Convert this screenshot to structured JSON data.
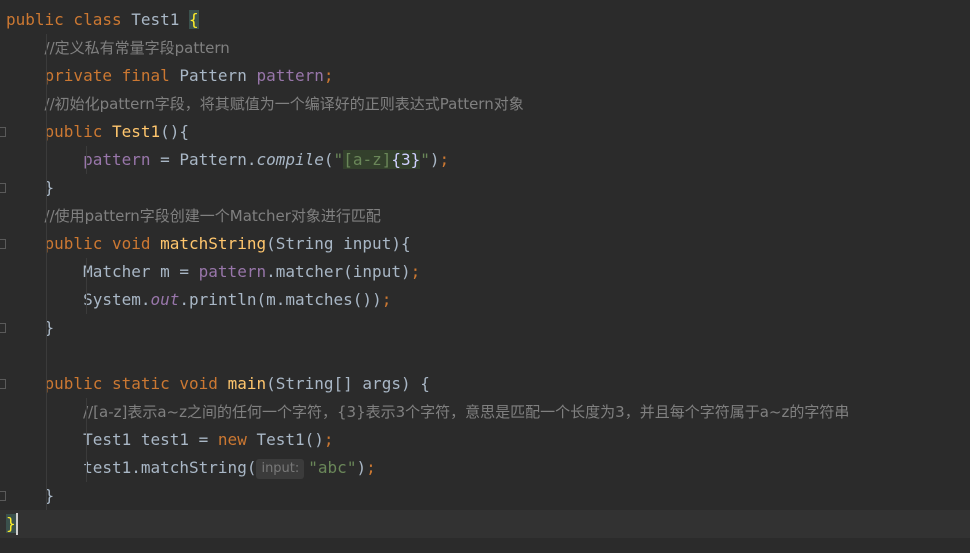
{
  "editor": {
    "lines": [
      {
        "tokens": [
          [
            "kw",
            "public class "
          ],
          [
            "",
            "Test1 "
          ],
          [
            "brace-hl",
            "{"
          ]
        ]
      },
      {
        "tokens": [
          [
            "",
            "    "
          ],
          [
            "cmt",
            "//定义私有常量字段pattern"
          ]
        ]
      },
      {
        "tokens": [
          [
            "",
            "    "
          ],
          [
            "kw",
            "private final "
          ],
          [
            "",
            "Pattern "
          ],
          [
            "field",
            "pattern"
          ],
          [
            "kw",
            ";"
          ]
        ]
      },
      {
        "tokens": [
          [
            "",
            "    "
          ],
          [
            "cmt",
            "//初始化pattern字段，将其赋值为一个编译好的正则表达式Pattern对象"
          ]
        ]
      },
      {
        "tokens": [
          [
            "",
            "    "
          ],
          [
            "kw",
            "public "
          ],
          [
            "fn",
            "Test1"
          ],
          [
            "",
            "(){"
          ]
        ]
      },
      {
        "tokens": [
          [
            "",
            "        "
          ],
          [
            "field",
            "pattern"
          ],
          [
            "",
            " = Pattern."
          ],
          [
            "static-mth",
            "compile"
          ],
          [
            "",
            "("
          ],
          [
            "str",
            "\""
          ],
          [
            "rx-bg rx",
            "[a-z]"
          ],
          [
            "rx-bg rx-q",
            "{3}"
          ],
          [
            "str",
            "\""
          ],
          [
            "",
            ")"
          ],
          [
            "kw",
            ";"
          ]
        ]
      },
      {
        "tokens": [
          [
            "",
            "    }"
          ]
        ]
      },
      {
        "tokens": [
          [
            "",
            "    "
          ],
          [
            "cmt",
            "//使用pattern字段创建一个Matcher对象进行匹配"
          ]
        ]
      },
      {
        "tokens": [
          [
            "",
            "    "
          ],
          [
            "kw",
            "public void "
          ],
          [
            "fn",
            "matchString"
          ],
          [
            "",
            "(String input){"
          ]
        ]
      },
      {
        "tokens": [
          [
            "",
            "        Matcher m = "
          ],
          [
            "field",
            "pattern"
          ],
          [
            "",
            ".matcher(input)"
          ],
          [
            "kw",
            ";"
          ]
        ]
      },
      {
        "tokens": [
          [
            "",
            "        System."
          ],
          [
            "static-fld",
            "out"
          ],
          [
            "",
            ".println(m.matches())"
          ],
          [
            "kw",
            ";"
          ]
        ]
      },
      {
        "tokens": [
          [
            "",
            "    }"
          ]
        ]
      },
      {
        "tokens": []
      },
      {
        "tokens": [
          [
            "",
            "    "
          ],
          [
            "kw",
            "public static void "
          ],
          [
            "fn",
            "main"
          ],
          [
            "",
            "(String[] args) {"
          ]
        ]
      },
      {
        "tokens": [
          [
            "",
            "        "
          ],
          [
            "cmt",
            "//[a-z]表示a~z之间的任何一个字符，{3}表示3个字符，意思是匹配一个长度为3，并且每个字符属于a~z的字符串"
          ]
        ]
      },
      {
        "tokens": [
          [
            "",
            "        Test1 test1 = "
          ],
          [
            "kw",
            "new "
          ],
          [
            "",
            "Test1()"
          ],
          [
            "kw",
            ";"
          ]
        ]
      },
      {
        "tokens": [
          [
            "",
            "        test1.matchString("
          ],
          [
            "hint",
            "input:"
          ],
          [
            "str",
            "\"abc\""
          ],
          [
            "",
            ")"
          ],
          [
            "kw",
            ";"
          ]
        ]
      },
      {
        "tokens": [
          [
            "",
            "    }"
          ]
        ]
      },
      {
        "tokens": [
          [
            "brace-hl",
            "}"
          ]
        ]
      }
    ]
  }
}
